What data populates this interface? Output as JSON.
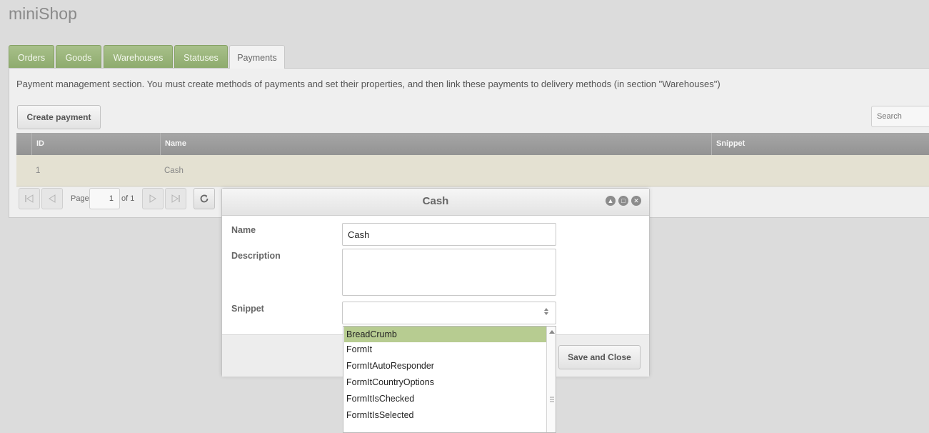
{
  "app": {
    "title": "miniShop"
  },
  "tabs": [
    {
      "label": "Orders"
    },
    {
      "label": "Goods"
    },
    {
      "label": "Warehouses"
    },
    {
      "label": "Statuses"
    },
    {
      "label": "Payments",
      "active": true
    }
  ],
  "section": {
    "description": "Payment management section. You must create methods of payments and set their properties, and then link these payments to delivery methods (in section \"Warehouses\")",
    "create_button": "Create payment",
    "search_placeholder": "Search"
  },
  "grid": {
    "columns": [
      "ID",
      "Name",
      "Snippet"
    ],
    "rows": [
      {
        "id": "1",
        "name": "Cash",
        "snippet": ""
      }
    ]
  },
  "pager": {
    "page_label": "Page",
    "page_value": "1",
    "of_label": "of 1"
  },
  "window": {
    "title": "Cash",
    "fields": {
      "name_label": "Name",
      "name_value": "Cash",
      "description_label": "Description",
      "description_value": "",
      "snippet_label": "Snippet",
      "snippet_value": ""
    },
    "save_button": "Save and Close"
  },
  "dropdown": {
    "options": [
      "BreadCrumb",
      "FormIt",
      "FormItAutoResponder",
      "FormItCountryOptions",
      "FormItIsChecked",
      "FormItIsSelected"
    ],
    "highlighted": "BreadCrumb"
  },
  "colors": {
    "tab_green": "#9cb47c",
    "row_highlight": "#e4e1d2",
    "option_highlight": "#b7cc91",
    "grid_header": "#9e9e9e"
  }
}
